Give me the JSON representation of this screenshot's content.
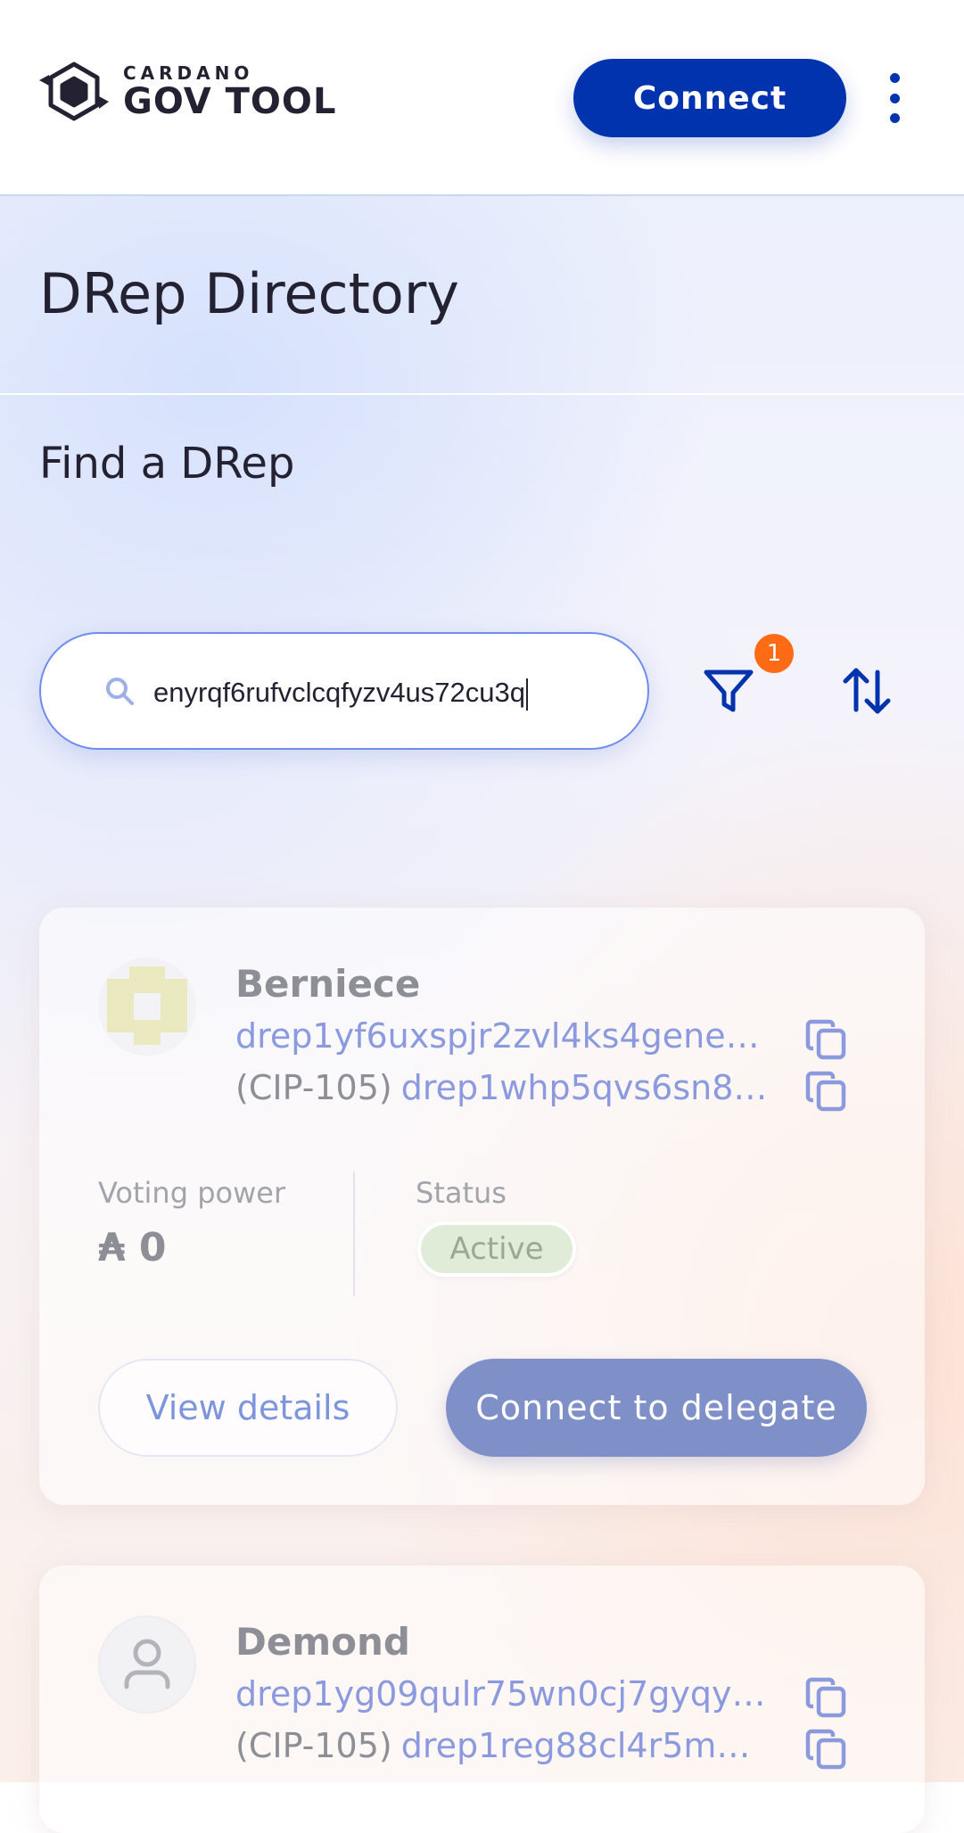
{
  "header": {
    "logo_top": "CARDANO",
    "logo_bottom": "GOV TOOL",
    "connect_label": "Connect"
  },
  "page": {
    "title": "DRep Directory",
    "section_title": "Find a DRep"
  },
  "search": {
    "value": "enyrqf6rufvclcqfyzv4us72cu3q",
    "filter_count": "1"
  },
  "cards": [
    {
      "name": "Berniece",
      "drep_id": "drep1yf6uxspjr2zvl4ks4gene…",
      "cip_label": "(CIP-105)",
      "cip_id": "drep1whp5qvs6sn8…",
      "voting_power_label": "Voting power",
      "voting_power": "₳ 0",
      "status_label": "Status",
      "status": "Active",
      "view_label": "View details",
      "delegate_label": "Connect to delegate"
    },
    {
      "name": "Demond",
      "drep_id": "drep1yg09qulr75wn0cj7gyqy…",
      "cip_label": "(CIP-105)",
      "cip_id": "drep1reg88cl4r5m…"
    }
  ],
  "colors": {
    "brand": "#0033ad",
    "badge": "#fe6b14",
    "status_active_bg": "#e0ecd8",
    "delegate_btn": "#7f8fc8"
  },
  "icons": {
    "logo": "gov-tool-logo-icon",
    "menu": "more-vertical-icon",
    "search": "search-icon",
    "filter": "filter-icon",
    "sort": "sort-icon",
    "copy": "copy-icon",
    "avatar": "user-icon"
  }
}
